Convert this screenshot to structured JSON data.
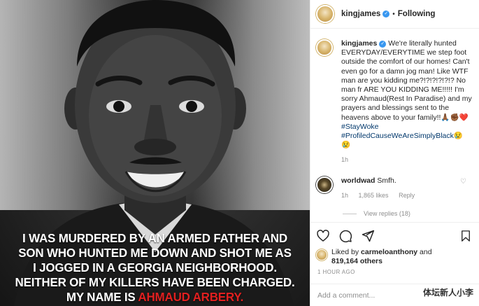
{
  "photo": {
    "caption_lines": [
      "I WAS MURDERED BY AN ARMED FATHER AND",
      "SON WHO HUNTED ME DOWN AND SHOT ME AS",
      "I JOGGED IN A GEORGIA NEIGHBORHOOD.",
      "NEITHER OF MY KILLERS HAVE BEEN CHARGED."
    ],
    "caption_last_prefix": "MY NAME IS ",
    "caption_last_name": "AHMAUD ARBERY.",
    "name_color": "#e02020"
  },
  "header": {
    "username": "kingjames",
    "verified_mark": "✓",
    "separator": "•",
    "follow_state": "Following"
  },
  "caption": {
    "username": "kingjames",
    "text_1": " We're literally hunted EVERYDAY/EVERYTIME we step foot outside the comfort of our homes! Can't even go for a damn jog man! Like WTF man are you kidding me?!?!?!?!?!? No man fr ARE YOU KIDDING ME!!!!! I'm sorry Ahmaud(Rest In Paradise) and my prayers and blessings sent to the heavens above to your family!!🙏🏾✊🏾❤️",
    "tag_1": "#StayWoke",
    "tag_2": "#ProfiledCauseWeAreSimplyBlack",
    "tag_2_emoji": "😢😢",
    "time": "1h"
  },
  "comment": {
    "username": "worldwad",
    "text": " Smfh.",
    "time": "1h",
    "likes": "1,865 likes",
    "reply": "Reply",
    "view_replies": "View replies (18)"
  },
  "likes": {
    "liked_by_prefix": "Liked by ",
    "liked_by_user": "carmeloanthony",
    "and": " and",
    "others": "819,164 others"
  },
  "time_ago": "1 HOUR AGO",
  "add_comment": {
    "placeholder": "Add a comment..."
  },
  "watermark": "体坛新人小李"
}
